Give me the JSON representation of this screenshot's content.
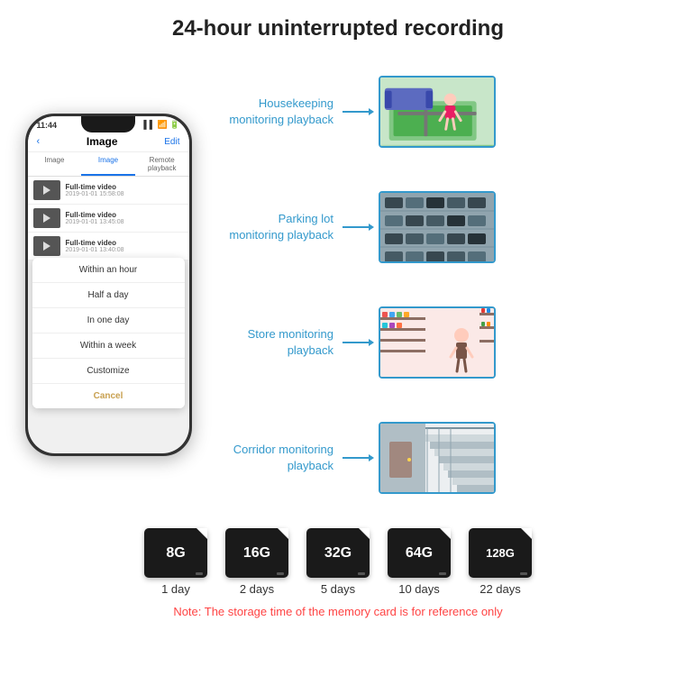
{
  "header": {
    "title": "24-hour uninterrupted recording"
  },
  "phone": {
    "time": "11:44",
    "screen_title": "Image",
    "screen_edit": "Edit",
    "tabs": [
      "Image",
      "Image",
      "Remote playback"
    ],
    "videos": [
      {
        "title": "Full-time video",
        "date": "2019-01-01 15:58:08"
      },
      {
        "title": "Full-time video",
        "date": "2019-01-01 13:45:08"
      },
      {
        "title": "Full-time video",
        "date": "2019-01-01 13:40:08"
      }
    ],
    "dropdown_items": [
      "Within an hour",
      "Half a day",
      "In one day",
      "Within a week",
      "Customize"
    ],
    "dropdown_cancel": "Cancel"
  },
  "monitoring": [
    {
      "label": "Housekeeping\nmonitoring playback",
      "type": "housekeeping"
    },
    {
      "label": "Parking lot\nmonitoring playback",
      "type": "parking"
    },
    {
      "label": "Store monitoring\nplayback",
      "type": "store"
    },
    {
      "label": "Corridor monitoring\nplayback",
      "type": "corridor"
    }
  ],
  "memory_cards": [
    {
      "size": "8G",
      "days": "1 day"
    },
    {
      "size": "16G",
      "days": "2 days"
    },
    {
      "size": "32G",
      "days": "5 days"
    },
    {
      "size": "64G",
      "days": "10 days"
    },
    {
      "size": "128G",
      "days": "22 days"
    }
  ],
  "note": "Note: The storage time of the memory card is for reference only"
}
